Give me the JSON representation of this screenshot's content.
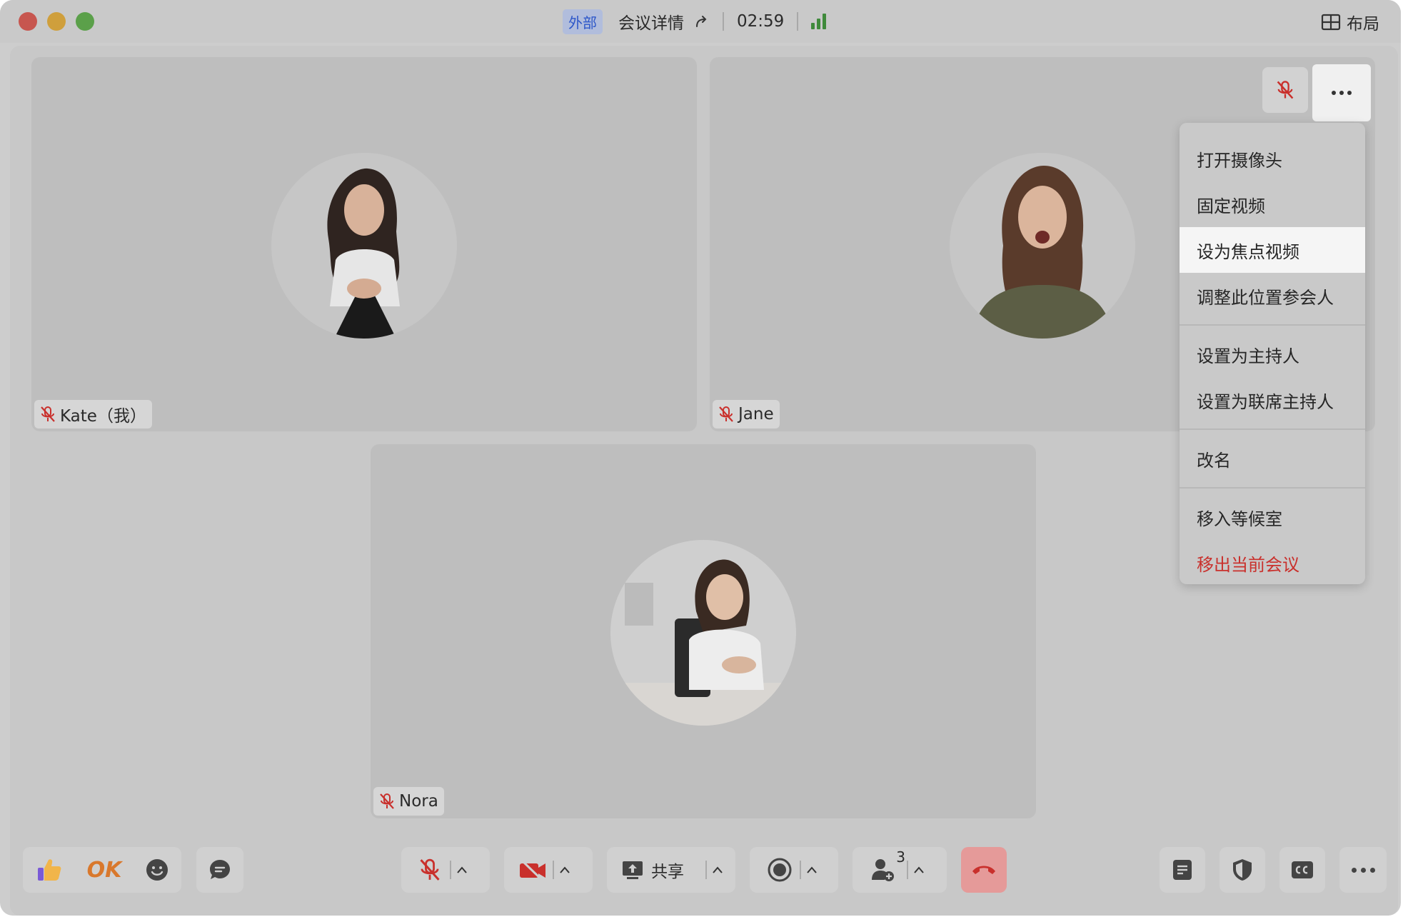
{
  "titlebar": {
    "badge": "外部",
    "meeting_details": "会议详情",
    "timer": "02:59",
    "layout_label": "布局"
  },
  "participants": [
    {
      "name": "Kate（我）",
      "muted": true
    },
    {
      "name": "Jane",
      "muted": true
    },
    {
      "name": "Nora",
      "muted": true
    }
  ],
  "context_menu": {
    "items": [
      {
        "label": "打开摄像头"
      },
      {
        "label": "固定视频"
      },
      {
        "label": "设为焦点视频",
        "highlighted": true
      },
      {
        "label": "调整此位置参会人"
      },
      {
        "label": "设置为主持人"
      },
      {
        "label": "设置为联席主持人"
      },
      {
        "label": "改名"
      },
      {
        "label": "移入等候室"
      },
      {
        "label": "移出当前会议",
        "danger": true
      }
    ]
  },
  "toolbar": {
    "ok_reaction": "OK",
    "share_label": "共享",
    "participants_count": "3"
  },
  "colors": {
    "danger": "#c9302c",
    "badge_text": "#2d57c9",
    "signal": "#3f8a3b",
    "hangup_bg": "#e59a99"
  }
}
